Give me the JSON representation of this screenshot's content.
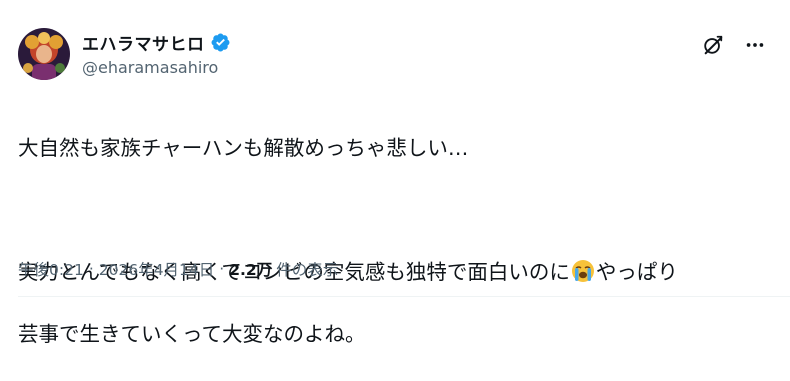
{
  "author": {
    "display_name": "エハラマサヒロ",
    "handle": "@eharamasahiro",
    "verified": true
  },
  "tweet": {
    "line1": "大自然も家族チャーハンも解散めっちゃ悲しい…",
    "line2_before_emoji": "実力とんでもなく高くてコンビの空気感も独特で面白いのに",
    "line2_after_emoji": "やっぱり",
    "line3": "芸事で生きていくって大変なのよね。",
    "emoji": "loudly-crying-face"
  },
  "meta": {
    "time": "午後0:21",
    "separator": "·",
    "date": "2026年4月14日",
    "views_count": "2.2万",
    "views_label": "件の表示"
  },
  "colors": {
    "text": "#0f1419",
    "secondary": "#536471",
    "verified": "#1d9bf0",
    "divider": "#eff3f4"
  },
  "icons": [
    "grok-icon",
    "more-icon",
    "verified-badge-icon"
  ]
}
